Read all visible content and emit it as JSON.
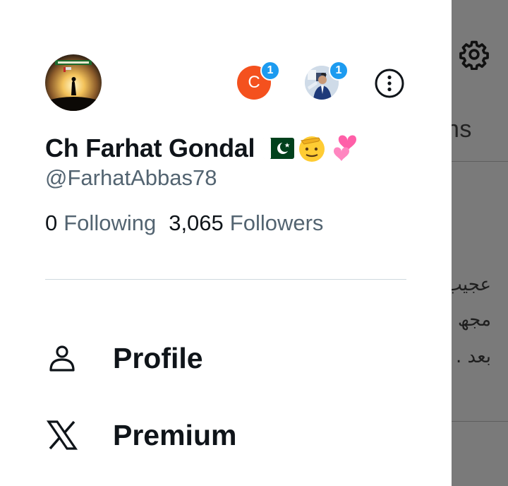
{
  "background": {
    "tab_text_fragment": "ns",
    "urdu_lines": [
      "عجیب",
      "مجھ",
      "بعد ."
    ]
  },
  "profile": {
    "display_name": "Ch Farhat Gondal",
    "name_emojis": [
      "pakistan-flag",
      "saluting-face",
      "two-hearts"
    ],
    "handle": "@FarhatAbbas78",
    "following_count": "0",
    "following_label": "Following",
    "followers_count": "3,065",
    "followers_label": "Followers"
  },
  "accounts": [
    {
      "initial": "C",
      "badge": "1",
      "color": "#f4511e"
    },
    {
      "initial": "",
      "badge": "1",
      "color": "#d9e3ee"
    }
  ],
  "menu": [
    {
      "label": "Profile",
      "icon": "person-icon"
    },
    {
      "label": "Premium",
      "icon": "x-logo-icon"
    }
  ],
  "colors": {
    "primary_text": "#0f1419",
    "secondary_text": "#536471",
    "badge": "#1d9bf0",
    "overlay": "#7a7a7a"
  }
}
